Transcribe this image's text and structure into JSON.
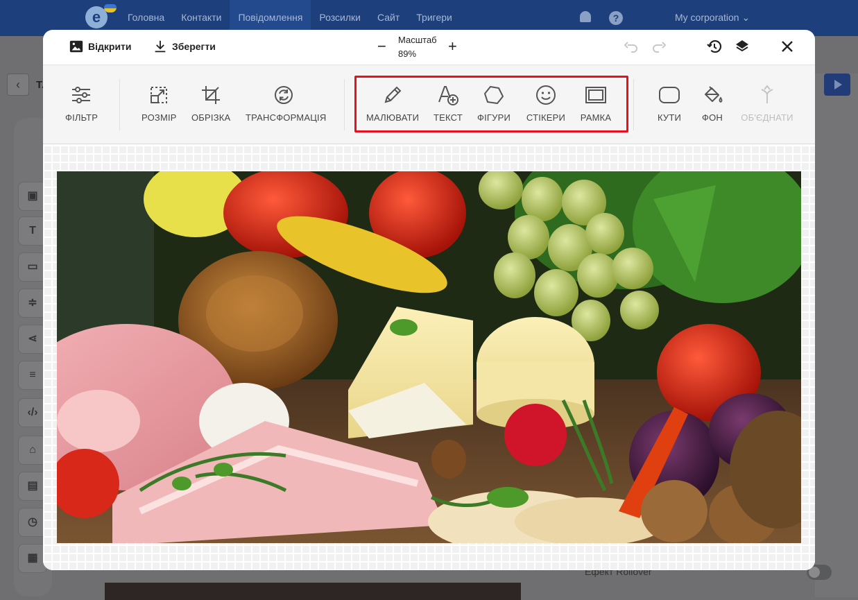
{
  "app": {
    "nav": [
      "Головна",
      "Контакти",
      "Повідомлення",
      "Розсилки",
      "Сайт",
      "Тригери"
    ],
    "active_nav": "Повідомлення",
    "corporation": "My corporation",
    "left_title": "ТА",
    "rollover_label": "Ефект Rollover"
  },
  "editor": {
    "open_label": "Відкрити",
    "save_label": "Зберегти",
    "zoom_label": "Масштаб",
    "zoom_value": "89%",
    "tools": {
      "filter": "ФІЛЬТР",
      "resize": "РОЗМІР",
      "crop": "ОБРІЗКА",
      "transform": "ТРАНСФОРМАЦІЯ",
      "draw": "МАЛЮВАТИ",
      "text": "ТЕКСТ",
      "shapes": "ФІГУРИ",
      "stickers": "СТІКЕРИ",
      "frame": "РАМКА",
      "corners": "КУТИ",
      "background": "ФОН",
      "merge": "ОБ'ЄДНАТИ"
    },
    "highlight_color": "#e8101c"
  }
}
